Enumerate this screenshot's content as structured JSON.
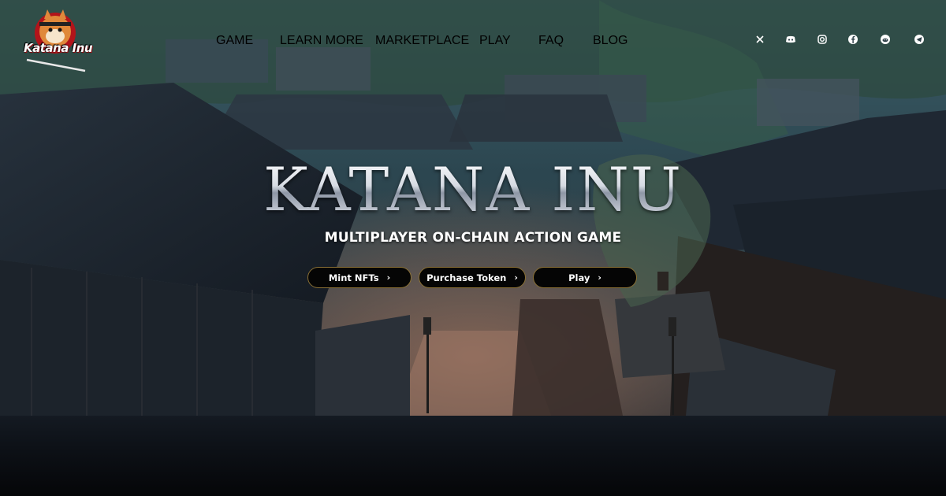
{
  "brand": {
    "logo_text": "Katana Inu"
  },
  "nav": {
    "items": [
      {
        "label": "GAME"
      },
      {
        "label": "LEARN MORE"
      },
      {
        "label": "MARKETPLACE"
      },
      {
        "label": "PLAY"
      },
      {
        "label": "FAQ"
      },
      {
        "label": "BLOG"
      }
    ]
  },
  "social": {
    "icons": [
      "x-icon",
      "discord-icon",
      "instagram-icon",
      "facebook-icon",
      "reddit-icon",
      "telegram-icon"
    ]
  },
  "hero": {
    "title": "KATANA INU",
    "subtitle": "MULTIPLAYER ON-CHAIN ACTION GAME",
    "buttons": [
      {
        "label": "Mint NFTs"
      },
      {
        "label": "Purchase Token"
      },
      {
        "label": "Play"
      }
    ]
  },
  "colors": {
    "button_border": "#8a7034",
    "button_bg": "#050505",
    "accent_red": "#b2141a"
  }
}
